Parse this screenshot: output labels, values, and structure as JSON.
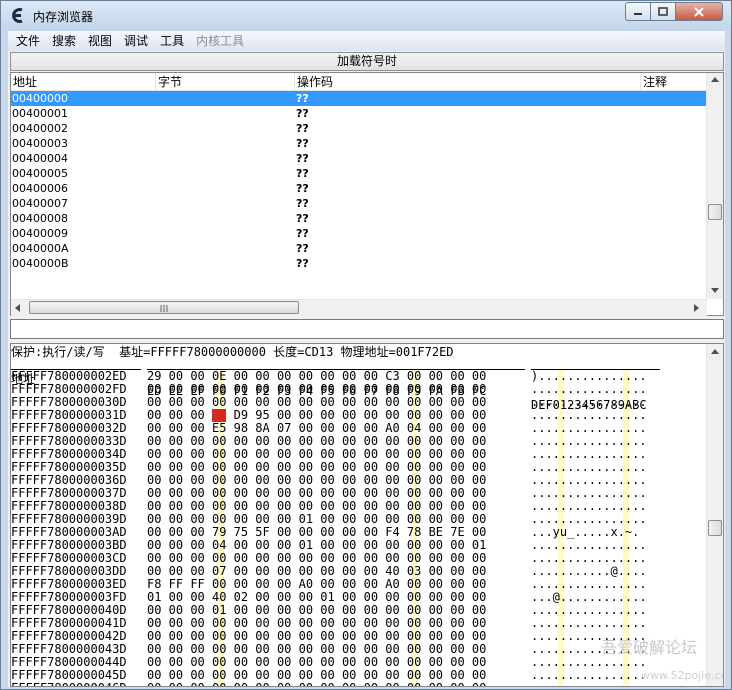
{
  "window": {
    "title": "内存浏览器"
  },
  "menu": {
    "items": [
      "文件",
      "搜索",
      "视图",
      "调试",
      "工具",
      "内核工具"
    ]
  },
  "symbols_button": "加载符号时",
  "disasm": {
    "columns": [
      "地址",
      "字节",
      "操作码",
      "注释"
    ],
    "rows": [
      {
        "addr": "00400000",
        "op": "??"
      },
      {
        "addr": "00400001",
        "op": "??"
      },
      {
        "addr": "00400002",
        "op": "??"
      },
      {
        "addr": "00400003",
        "op": "??"
      },
      {
        "addr": "00400004",
        "op": "??"
      },
      {
        "addr": "00400005",
        "op": "??"
      },
      {
        "addr": "00400006",
        "op": "??"
      },
      {
        "addr": "00400007",
        "op": "??"
      },
      {
        "addr": "00400008",
        "op": "??"
      },
      {
        "addr": "00400009",
        "op": "??"
      },
      {
        "addr": "0040000A",
        "op": "??"
      },
      {
        "addr": "0040000B",
        "op": "??"
      }
    ],
    "selected_row": 0
  },
  "hex": {
    "info": "保护:执行/读/写  基址=FFFFF78000000000 长度=CD13 物理地址=001F72ED",
    "address_label": "地址",
    "column_header": "EDEEEFF0F1F2F3F4F5F6F7F8F9FAFBFC",
    "ascii_header": "DEF0123456789ABC",
    "highlight_byte": "3",
    "rows": [
      {
        "addr": "FFFFF780000002ED",
        "bytes": "29 00 00 0E 00 00 00 00 00 00 00 C3 00 00 00 00",
        "ascii": ")..............."
      },
      {
        "addr": "FFFFF780000002FD",
        "bytes": "00 00 00 00 00 00 00 00 00 00 00 00 00 00 00 00",
        "ascii": "................"
      },
      {
        "addr": "FFFFF7800000030D",
        "bytes": "00 00 00 00 00 00 00 00 00 00 00 00 00 00 00 00",
        "ascii": "................"
      },
      {
        "addr": "FFFFF7800000031D",
        "bytes": "00 00 00 00 D9 95 00 00 00 00 00 00 00 00 00 00",
        "ascii": "................"
      },
      {
        "addr": "FFFFF7800000032D",
        "bytes": "00 00 00 E5 98 8A 07 00 00 00 00 A0 04 00 00 00",
        "ascii": "................"
      },
      {
        "addr": "FFFFF7800000033D",
        "bytes": "00 00 00 00 00 00 00 00 00 00 00 00 00 00 00 00",
        "ascii": "................"
      },
      {
        "addr": "FFFFF7800000034D",
        "bytes": "00 00 00 00 00 00 00 00 00 00 00 00 00 00 00 00",
        "ascii": "................"
      },
      {
        "addr": "FFFFF7800000035D",
        "bytes": "00 00 00 00 00 00 00 00 00 00 00 00 00 00 00 00",
        "ascii": "................"
      },
      {
        "addr": "FFFFF7800000036D",
        "bytes": "00 00 00 00 00 00 00 00 00 00 00 00 00 00 00 00",
        "ascii": "................"
      },
      {
        "addr": "FFFFF7800000037D",
        "bytes": "00 00 00 00 00 00 00 00 00 00 00 00 00 00 00 00",
        "ascii": "................"
      },
      {
        "addr": "FFFFF7800000038D",
        "bytes": "00 00 00 00 00 00 00 00 00 00 00 00 00 00 00 00",
        "ascii": "................"
      },
      {
        "addr": "FFFFF7800000039D",
        "bytes": "00 00 00 00 00 00 00 01 00 00 00 00 00 00 00 00",
        "ascii": "................"
      },
      {
        "addr": "FFFFF780000003AD",
        "bytes": "00 00 00 79 75 5F 00 00 00 00 00 F4 78 BE 7E 00",
        "ascii": "...yu_.....x.~."
      },
      {
        "addr": "FFFFF780000003BD",
        "bytes": "00 00 00 04 00 00 00 01 00 00 00 00 00 00 00 01",
        "ascii": "................"
      },
      {
        "addr": "FFFFF780000003CD",
        "bytes": "00 00 00 00 00 00 00 00 00 00 00 00 00 00 00 00",
        "ascii": "................"
      },
      {
        "addr": "FFFFF780000003DD",
        "bytes": "00 00 00 07 00 00 00 00 00 00 00 40 03 00 00 00",
        "ascii": "...........@...."
      },
      {
        "addr": "FFFFF780000003ED",
        "bytes": "F8 FF FF 00 00 00 00 A0 00 00 00 A0 00 00 00 00",
        "ascii": "................"
      },
      {
        "addr": "FFFFF780000003FD",
        "bytes": "01 00 00 40 02 00 00 00 01 00 00 00 00 00 00 00",
        "ascii": "...@............"
      },
      {
        "addr": "FFFFF7800000040D",
        "bytes": "00 00 00 01 00 00 00 00 00 00 00 00 00 00 00 00",
        "ascii": "................"
      },
      {
        "addr": "FFFFF7800000041D",
        "bytes": "00 00 00 00 00 00 00 00 00 00 00 00 00 00 00 00",
        "ascii": "................"
      },
      {
        "addr": "FFFFF7800000042D",
        "bytes": "00 00 00 00 00 00 00 00 00 00 00 00 00 00 00 00",
        "ascii": "................"
      },
      {
        "addr": "FFFFF7800000043D",
        "bytes": "00 00 00 00 00 00 00 00 00 00 00 00 00 00 00 00",
        "ascii": "................"
      },
      {
        "addr": "FFFFF7800000044D",
        "bytes": "00 00 00 00 00 00 00 00 00 00 00 00 00 00 00 00",
        "ascii": "................"
      },
      {
        "addr": "FFFFF7800000045D",
        "bytes": "00 00 00 00 00 00 00 00 00 00 00 00 00 00 00 00",
        "ascii": "................"
      },
      {
        "addr": "FFFFF7800000046D",
        "bytes": "00 00 00 00 00 00 00 00 00 00 00 00 00 00 00 00",
        "ascii": "................"
      },
      {
        "addr": "FFFFF7800000047D",
        "bytes": "00 00 00 00 00 00 00 00 00 00 00 00 00 00 00 00",
        "ascii": "................"
      }
    ]
  },
  "watermark": {
    "text": "吾爱破解论坛",
    "url": "www.52pojie.cn"
  },
  "colors": {
    "selection": "#3399ff",
    "highlight_byte": "#d42a1e",
    "column_highlight": "#fffbc4"
  }
}
